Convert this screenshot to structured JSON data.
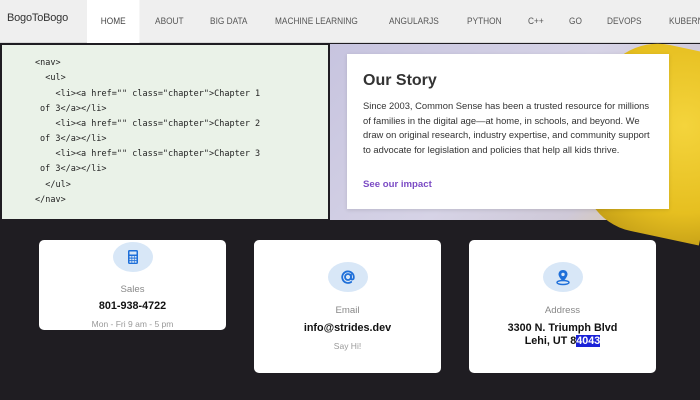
{
  "nav": {
    "brand": "BogoToBogo",
    "items": [
      {
        "label": "HOME",
        "active": true
      },
      {
        "label": "ABOUT"
      },
      {
        "label": "BIG DATA"
      },
      {
        "label": "MACHINE LEARNING"
      },
      {
        "label": "ANGULARJS"
      },
      {
        "label": "PYTHON"
      },
      {
        "label": "C++"
      },
      {
        "label": "GO"
      },
      {
        "label": "DEVOPS"
      },
      {
        "label": "KUBERNETES"
      }
    ]
  },
  "code": {
    "lines": [
      "<nav>",
      "  <ul>",
      "    <li><a href=\"\" class=\"chapter\">Chapter 1",
      "of 3</a></li>",
      "    <li><a href=\"\" class=\"chapter\">Chapter 2",
      "of 3</a></li>",
      "    <li><a href=\"\" class=\"chapter\">Chapter 3",
      "of 3</a></li>",
      "  </ul>",
      "</nav>"
    ]
  },
  "story": {
    "title": "Our Story",
    "text": "Since 2003, Common Sense has been a trusted resource for millions of families in the digital age—at home, in schools, and beyond. We draw on original research, industry expertise, and community support to advocate for legislation and policies that help all kids thrive.",
    "link": "See our impact"
  },
  "contacts": {
    "sales": {
      "icon": "calculator-icon",
      "label": "Sales",
      "value": "801-938-4722",
      "sub": "Mon - Fri 9 am - 5 pm"
    },
    "email": {
      "icon": "at-sign-icon",
      "label": "Email",
      "value": "info@strides.dev",
      "sub": "Say Hi!"
    },
    "address": {
      "icon": "map-pin-icon",
      "label": "Address",
      "line1": "3300 N. Triumph Blvd",
      "line2_prefix": "Lehi, UT 8",
      "line2_selected": "4043"
    }
  },
  "colors": {
    "link": "#7b4bc4",
    "selection": "#1a22d8",
    "icon_bg": "#d8e7f7",
    "icon_fg": "#1e6fd9"
  }
}
